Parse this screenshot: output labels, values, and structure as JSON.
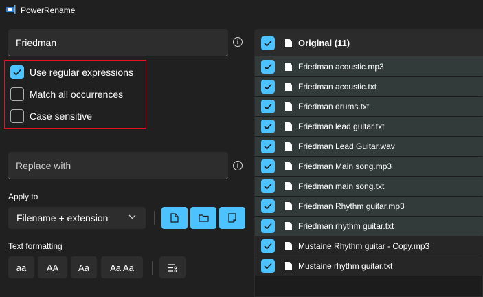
{
  "window": {
    "title": "PowerRename"
  },
  "search": {
    "value": "Friedman"
  },
  "options": [
    {
      "label": "Use regular expressions",
      "checked": true
    },
    {
      "label": "Match all occurrences",
      "checked": false
    },
    {
      "label": "Case sensitive",
      "checked": false
    }
  ],
  "replace": {
    "placeholder": "Replace with"
  },
  "apply_to": {
    "label": "Apply to",
    "selected": "Filename + extension",
    "mode_buttons": [
      "file-icon",
      "folder-icon",
      "subfolder-icon"
    ]
  },
  "text_formatting": {
    "label": "Text formatting",
    "buttons": [
      "aa",
      "AA",
      "Aa",
      "Aa Aa"
    ]
  },
  "file_list": {
    "header": "Original (11)",
    "items": [
      "Friedman acoustic.mp3",
      "Friedman acoustic.txt",
      "Friedman drums.txt",
      "Friedman lead guitar.txt",
      "Friedman Lead Guitar.wav",
      "Friedman Main song.mp3",
      "Friedman main song.txt",
      "Friedman Rhythm guitar.mp3",
      "Friedman rhythm guitar.txt",
      "Mustaine Rhythm guitar - Copy.mp3",
      "Mustaine rhythm guitar.txt"
    ]
  },
  "colors": {
    "accent": "#4cc2ff",
    "highlight_box": "#e81123",
    "background": "#202020",
    "matched_row": "#323b3a"
  }
}
